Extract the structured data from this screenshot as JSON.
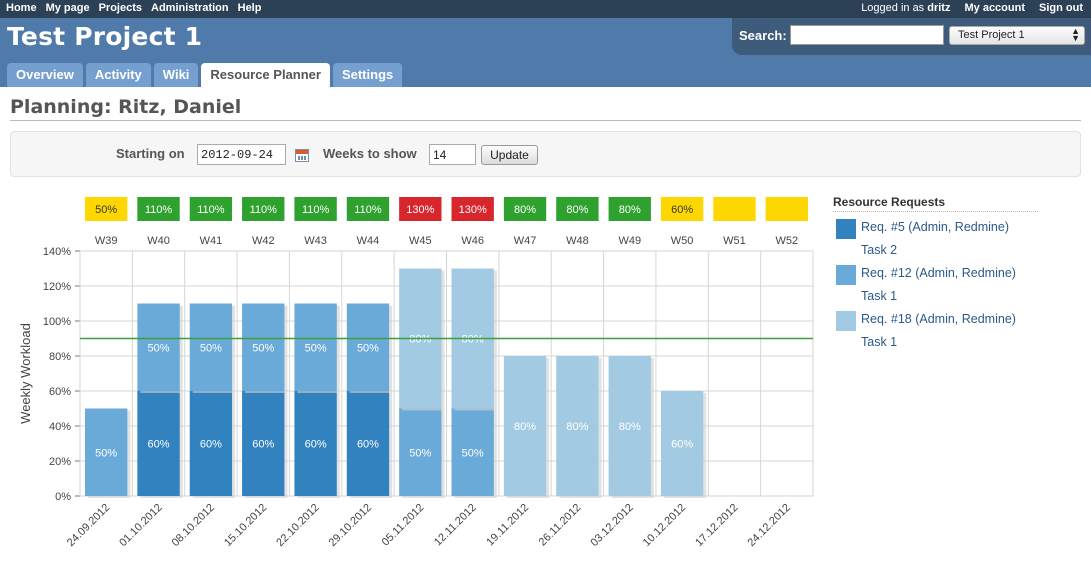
{
  "top_menu": {
    "left": [
      "Home",
      "My page",
      "Projects",
      "Administration",
      "Help"
    ],
    "logged_in_prefix": "Logged in as",
    "user": "dritz",
    "right": [
      "My account",
      "Sign out"
    ]
  },
  "header": {
    "project_title": "Test Project 1",
    "search_label": "Search:",
    "search_value": "",
    "project_select": "Test Project 1"
  },
  "tabs": [
    {
      "label": "Overview",
      "selected": false
    },
    {
      "label": "Activity",
      "selected": false
    },
    {
      "label": "Wiki",
      "selected": false
    },
    {
      "label": "Resource Planner",
      "selected": true
    },
    {
      "label": "Settings",
      "selected": false
    }
  ],
  "page": {
    "title": "Planning: Ritz, Daniel"
  },
  "filters": {
    "starting_on_label": "Starting on",
    "starting_on_value": "2012-09-24",
    "weeks_label": "Weeks to show",
    "weeks_value": "14",
    "update_label": "Update"
  },
  "colors": {
    "req5": "#3282c0",
    "req12": "#6aaad8",
    "req18": "#a2cbe3",
    "status_green": "#2ea12e",
    "status_red": "#d7262c",
    "status_yellow": "#ffd700",
    "threshold_line": "#3c9e3c"
  },
  "chart_data": {
    "type": "bar",
    "stacked": true,
    "ylabel": "Weekly Workload",
    "ylim": [
      0,
      140
    ],
    "yticks": [
      "0%",
      "20%",
      "40%",
      "60%",
      "80%",
      "100%",
      "120%",
      "140%"
    ],
    "threshold": 90,
    "grid": true,
    "weeks": [
      "W39",
      "W40",
      "W41",
      "W42",
      "W43",
      "W44",
      "W45",
      "W46",
      "W47",
      "W48",
      "W49",
      "W50",
      "W51",
      "W52"
    ],
    "categories": [
      "24.09.2012",
      "01.10.2012",
      "08.10.2012",
      "15.10.2012",
      "22.10.2012",
      "29.10.2012",
      "05.11.2012",
      "12.11.2012",
      "19.11.2012",
      "26.11.2012",
      "03.12.2012",
      "10.12.2012",
      "17.12.2012",
      "24.12.2012"
    ],
    "totals": [
      {
        "label": "50%",
        "status": "yellow"
      },
      {
        "label": "110%",
        "status": "green"
      },
      {
        "label": "110%",
        "status": "green"
      },
      {
        "label": "110%",
        "status": "green"
      },
      {
        "label": "110%",
        "status": "green"
      },
      {
        "label": "110%",
        "status": "green"
      },
      {
        "label": "130%",
        "status": "red"
      },
      {
        "label": "130%",
        "status": "red"
      },
      {
        "label": "80%",
        "status": "green"
      },
      {
        "label": "80%",
        "status": "green"
      },
      {
        "label": "80%",
        "status": "green"
      },
      {
        "label": "60%",
        "status": "yellow"
      },
      {
        "label": "",
        "status": "yellow"
      },
      {
        "label": "",
        "status": "yellow"
      }
    ],
    "series": [
      {
        "key": "req5",
        "values": [
          0,
          60,
          60,
          60,
          60,
          60,
          0,
          0,
          0,
          0,
          0,
          0,
          0,
          0
        ]
      },
      {
        "key": "req12",
        "values": [
          50,
          50,
          50,
          50,
          50,
          50,
          50,
          50,
          0,
          0,
          0,
          0,
          0,
          0
        ]
      },
      {
        "key": "req18",
        "values": [
          0,
          0,
          0,
          0,
          0,
          0,
          80,
          80,
          80,
          80,
          80,
          60,
          0,
          0
        ]
      }
    ]
  },
  "resource_requests": {
    "title": "Resource Requests",
    "items": [
      {
        "color_key": "req5",
        "name": "Req. #5 (Admin, Redmine)",
        "task": "Task 2"
      },
      {
        "color_key": "req12",
        "name": "Req. #12 (Admin, Redmine)",
        "task": "Task 1"
      },
      {
        "color_key": "req18",
        "name": "Req. #18 (Admin, Redmine)",
        "task": "Task 1"
      }
    ]
  }
}
